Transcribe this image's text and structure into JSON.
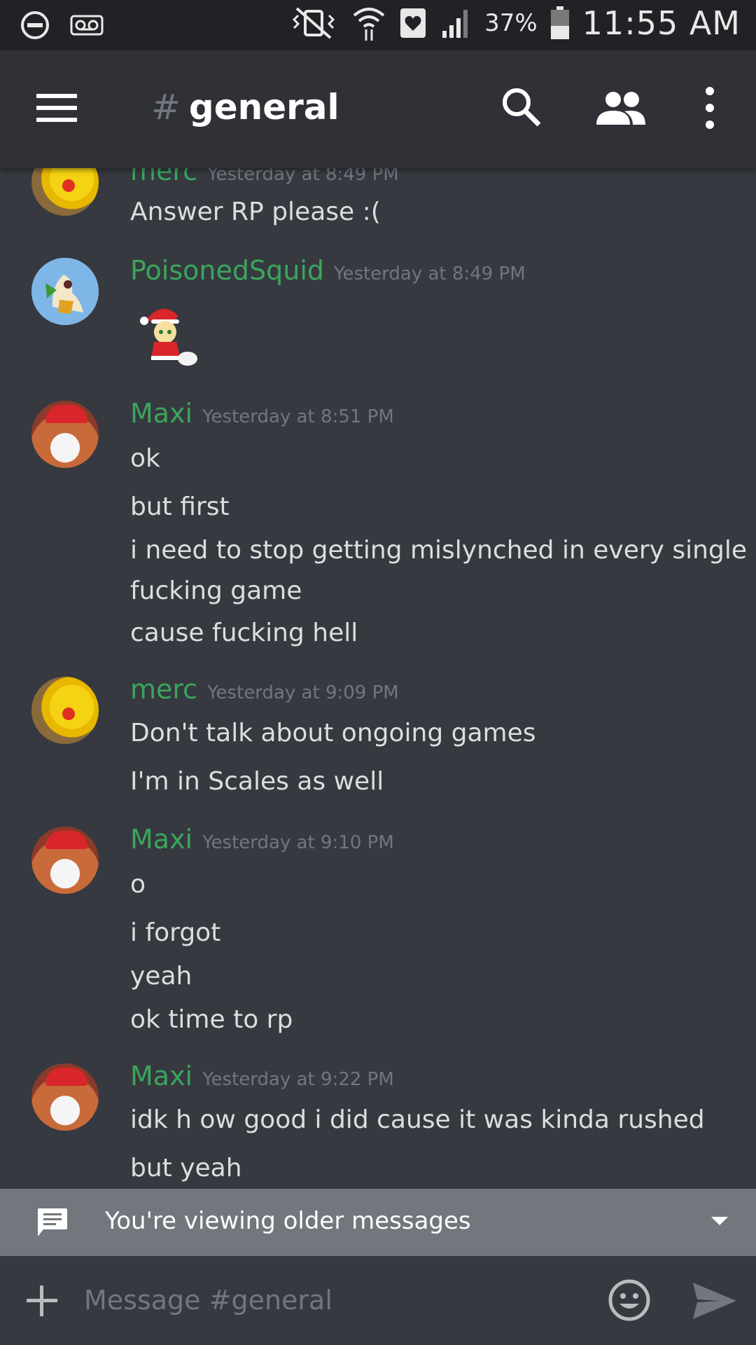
{
  "status_bar": {
    "battery_percent": "37%",
    "time": "11:55 AM"
  },
  "header": {
    "hash": "#",
    "channel_name": "general"
  },
  "messages": [
    {
      "author": "merc",
      "timestamp": "Yesterday at 8:49 PM",
      "lines": [
        "Answer RP please :("
      ]
    },
    {
      "author": "PoisonedSquid",
      "timestamp": "Yesterday at 8:49 PM",
      "lines": []
    },
    {
      "author": "Maxi",
      "timestamp": "Yesterday at 8:51 PM",
      "lines": [
        "ok",
        "but first",
        "i need to stop getting mislynched in every single",
        "fucking game",
        "cause fucking hell"
      ]
    },
    {
      "author": "merc",
      "timestamp": "Yesterday at 9:09 PM",
      "lines": [
        "Don't talk about ongoing games",
        "I'm in Scales as well"
      ]
    },
    {
      "author": "Maxi",
      "timestamp": "Yesterday at 9:10 PM",
      "lines": [
        "o",
        "i forgot",
        "yeah",
        "ok time to rp"
      ]
    },
    {
      "author": "Maxi",
      "timestamp": "Yesterday at 9:22 PM",
      "lines": [
        "idk h ow good i did cause it was kinda rushed",
        "but yeah"
      ]
    }
  ],
  "banner": {
    "text": "You're viewing older messages"
  },
  "composer": {
    "placeholder": "Message #general"
  },
  "colors": {
    "background": "#36393f",
    "header": "#2f3136",
    "author_green": "#3ba55c",
    "banner": "#72767d"
  }
}
